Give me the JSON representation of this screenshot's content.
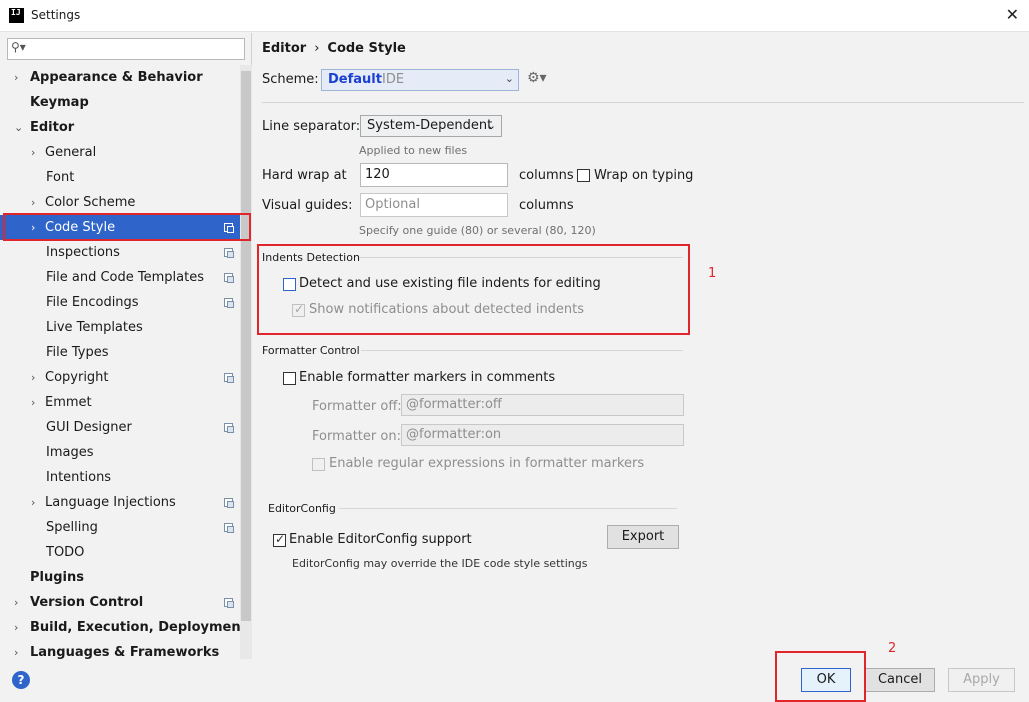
{
  "window": {
    "app_icon": "IJ",
    "title": "Settings",
    "close_glyph": "✕"
  },
  "search": {
    "icon": "search-icon",
    "placeholder": ""
  },
  "tree": [
    {
      "label": "Appearance & Behavior",
      "bold": true,
      "arrow": "›",
      "indent": 0,
      "copy": false
    },
    {
      "label": "Keymap",
      "bold": true,
      "arrow": "",
      "indent": 0,
      "copy": false
    },
    {
      "label": "Editor",
      "bold": true,
      "arrow": "⌄",
      "indent": 0,
      "copy": false
    },
    {
      "label": "General",
      "bold": false,
      "arrow": "›",
      "indent": 1,
      "copy": false
    },
    {
      "label": "Font",
      "bold": false,
      "arrow": "",
      "indent": 1,
      "copy": false
    },
    {
      "label": "Color Scheme",
      "bold": false,
      "arrow": "›",
      "indent": 1,
      "copy": false
    },
    {
      "label": "Code Style",
      "bold": false,
      "arrow": "›",
      "indent": 1,
      "copy": true,
      "selected": true
    },
    {
      "label": "Inspections",
      "bold": false,
      "arrow": "",
      "indent": 1,
      "copy": true
    },
    {
      "label": "File and Code Templates",
      "bold": false,
      "arrow": "",
      "indent": 1,
      "copy": true
    },
    {
      "label": "File Encodings",
      "bold": false,
      "arrow": "",
      "indent": 1,
      "copy": true
    },
    {
      "label": "Live Templates",
      "bold": false,
      "arrow": "",
      "indent": 1,
      "copy": false
    },
    {
      "label": "File Types",
      "bold": false,
      "arrow": "",
      "indent": 1,
      "copy": false
    },
    {
      "label": "Copyright",
      "bold": false,
      "arrow": "›",
      "indent": 1,
      "copy": true
    },
    {
      "label": "Emmet",
      "bold": false,
      "arrow": "›",
      "indent": 1,
      "copy": false
    },
    {
      "label": "GUI Designer",
      "bold": false,
      "arrow": "",
      "indent": 1,
      "copy": true
    },
    {
      "label": "Images",
      "bold": false,
      "arrow": "",
      "indent": 1,
      "copy": false
    },
    {
      "label": "Intentions",
      "bold": false,
      "arrow": "",
      "indent": 1,
      "copy": false
    },
    {
      "label": "Language Injections",
      "bold": false,
      "arrow": "›",
      "indent": 1,
      "copy": true
    },
    {
      "label": "Spelling",
      "bold": false,
      "arrow": "",
      "indent": 1,
      "copy": true
    },
    {
      "label": "TODO",
      "bold": false,
      "arrow": "",
      "indent": 1,
      "copy": false
    },
    {
      "label": "Plugins",
      "bold": true,
      "arrow": "",
      "indent": 0,
      "copy": false
    },
    {
      "label": "Version Control",
      "bold": true,
      "arrow": "›",
      "indent": 0,
      "copy": true
    },
    {
      "label": "Build, Execution, Deployment",
      "bold": true,
      "arrow": "›",
      "indent": 0,
      "copy": false
    },
    {
      "label": "Languages & Frameworks",
      "bold": true,
      "arrow": "›",
      "indent": 0,
      "copy": false
    }
  ],
  "breadcrumb": {
    "first": "Editor",
    "sep": "›",
    "second": "Code Style"
  },
  "scheme": {
    "label": "Scheme:",
    "name": "Default",
    "kind": "IDE",
    "dropdown": "⌄",
    "gear": "⚙▾"
  },
  "line_separator": {
    "label": "Line separator:",
    "value": "System-Dependent",
    "dropdown": "⌄",
    "hint": "Applied to new files"
  },
  "hard_wrap": {
    "label": "Hard wrap at",
    "value": "120",
    "unit": "columns",
    "wrap_label": "Wrap on typing"
  },
  "visual_guides": {
    "label": "Visual guides:",
    "placeholder": "Optional",
    "unit": "columns",
    "hint": "Specify one guide (80) or several (80, 120)"
  },
  "indents": {
    "title": "Indents Detection",
    "detect_label": "Detect and use existing file indents for editing",
    "notify_label": "Show notifications about detected indents",
    "notify_tick": "✓"
  },
  "formatter": {
    "title": "Formatter Control",
    "enable_label": "Enable formatter markers in comments",
    "off_label": "Formatter off:",
    "off_value": "@formatter:off",
    "on_label": "Formatter on:",
    "on_value": "@formatter:on",
    "regex_label": "Enable regular expressions in formatter markers"
  },
  "editorconfig": {
    "title": "EditorConfig",
    "enable_label": "Enable EditorConfig support",
    "tick": "✓",
    "export_label": "Export",
    "note": "EditorConfig may override the IDE code style settings"
  },
  "annotations": {
    "one": "1",
    "two": "2"
  },
  "buttons": {
    "help": "?",
    "ok": "OK",
    "cancel": "Cancel",
    "apply": "Apply"
  },
  "colors": {
    "selection": "#2f65ca",
    "annotation": "#e0262b",
    "scheme_name": "#1a3fd4"
  }
}
